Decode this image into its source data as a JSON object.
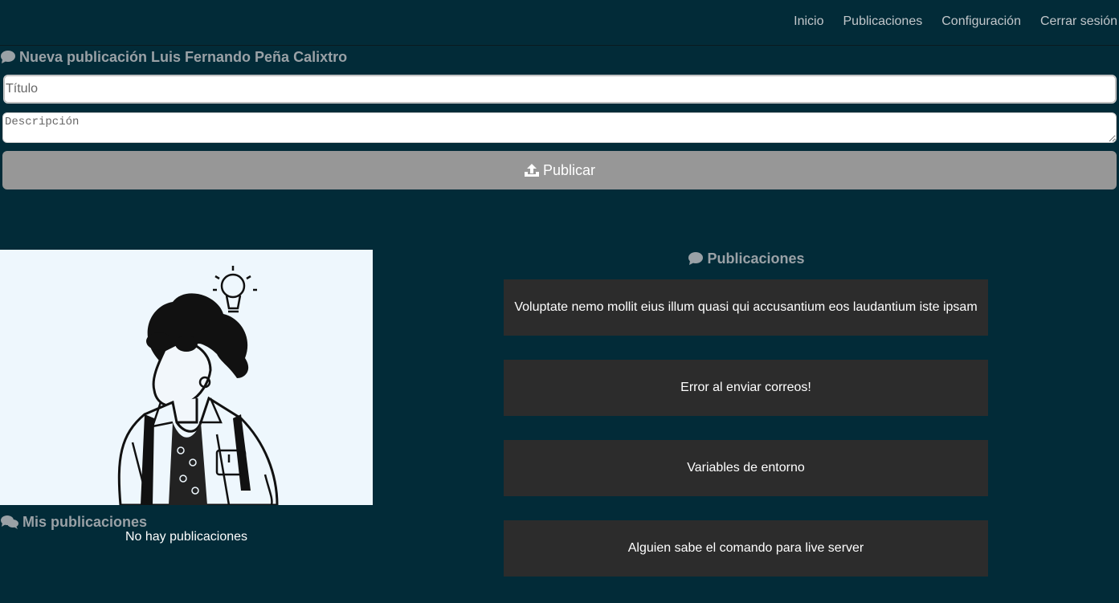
{
  "nav": {
    "items": [
      "Inicio",
      "Publicaciones",
      "Configuración",
      "Cerrar sesión"
    ]
  },
  "new_post": {
    "heading": "Nueva publicación Luis Fernando Peña Calixtro",
    "title_placeholder": "Título",
    "description_placeholder": "Descripción",
    "publish_label": "Publicar"
  },
  "my_posts": {
    "heading": "Mis publicaciones",
    "empty_text": "No hay publicaciones"
  },
  "posts": {
    "heading": "Publicaciones",
    "items": [
      "Voluptate nemo mollit eius illum quasi qui accusantium eos laudantium iste ipsam",
      "Error al enviar correos!",
      "Variables de entorno",
      "Alguien sabe el comando para live server"
    ]
  },
  "colors": {
    "background": "#022b38",
    "publish_button": "#979797",
    "card": "#2c2c2c",
    "heading": "#9aa1a6"
  },
  "icons": [
    "comment-icon",
    "comments-icon",
    "upload-icon"
  ]
}
